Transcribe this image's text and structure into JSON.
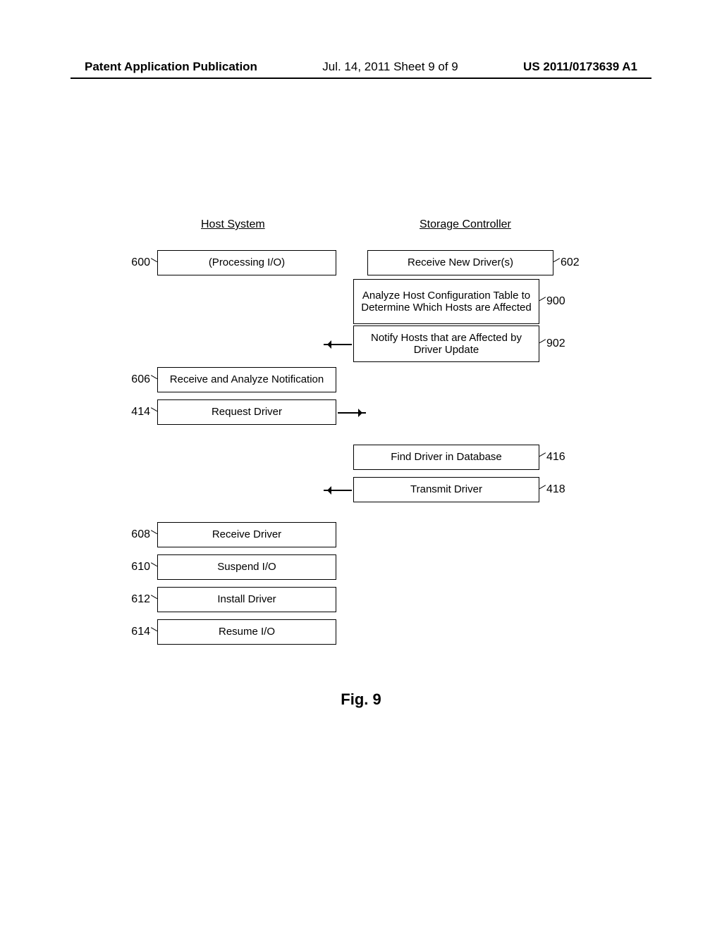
{
  "header": {
    "left": "Patent Application Publication",
    "mid": "Jul. 14, 2011   Sheet 9 of 9",
    "right": "US 2011/0173639 A1"
  },
  "cols": {
    "host": "Host System",
    "stor": "Storage Controller"
  },
  "labels": {
    "h600": "(Processing I/O)",
    "s602": "Receive New Driver(s)",
    "s900": "Analyze Host Configuration Table to Determine Which Hosts are Affected",
    "s902": "Notify Hosts that are Affected by Driver Update",
    "h606": "Receive and Analyze Notification",
    "h414": "Request Driver",
    "s416": "Find Driver in Database",
    "s418": "Transmit Driver",
    "h608": "Receive Driver",
    "h610": "Suspend I/O",
    "h612": "Install Driver",
    "h614": "Resume I/O"
  },
  "refs": {
    "r600": "600",
    "r602": "602",
    "r900": "900",
    "r902": "902",
    "r606": "606",
    "r414": "414",
    "r416": "416",
    "r418": "418",
    "r608": "608",
    "r610": "610",
    "r612": "612",
    "r614": "614"
  },
  "figure": "Fig. 9"
}
